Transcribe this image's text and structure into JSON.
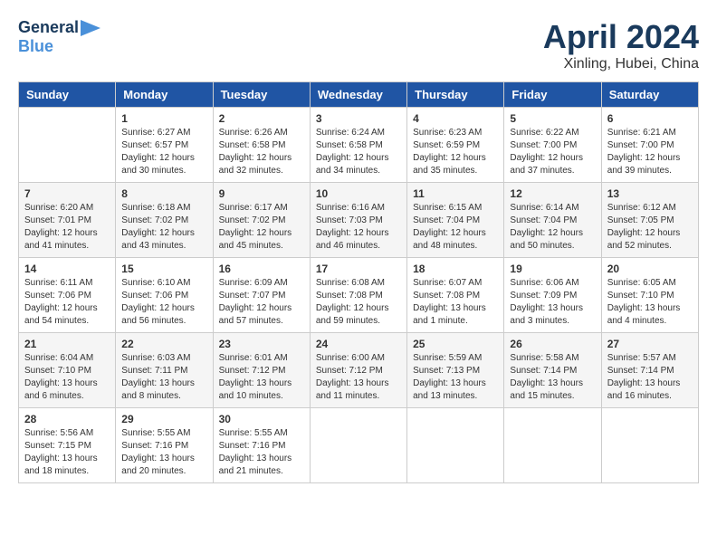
{
  "logo": {
    "line1": "General",
    "line2": "Blue"
  },
  "title": "April 2024",
  "location": "Xinling, Hubei, China",
  "headers": [
    "Sunday",
    "Monday",
    "Tuesday",
    "Wednesday",
    "Thursday",
    "Friday",
    "Saturday"
  ],
  "weeks": [
    [
      {
        "day": "",
        "detail": ""
      },
      {
        "day": "1",
        "detail": "Sunrise: 6:27 AM\nSunset: 6:57 PM\nDaylight: 12 hours\nand 30 minutes."
      },
      {
        "day": "2",
        "detail": "Sunrise: 6:26 AM\nSunset: 6:58 PM\nDaylight: 12 hours\nand 32 minutes."
      },
      {
        "day": "3",
        "detail": "Sunrise: 6:24 AM\nSunset: 6:58 PM\nDaylight: 12 hours\nand 34 minutes."
      },
      {
        "day": "4",
        "detail": "Sunrise: 6:23 AM\nSunset: 6:59 PM\nDaylight: 12 hours\nand 35 minutes."
      },
      {
        "day": "5",
        "detail": "Sunrise: 6:22 AM\nSunset: 7:00 PM\nDaylight: 12 hours\nand 37 minutes."
      },
      {
        "day": "6",
        "detail": "Sunrise: 6:21 AM\nSunset: 7:00 PM\nDaylight: 12 hours\nand 39 minutes."
      }
    ],
    [
      {
        "day": "7",
        "detail": "Sunrise: 6:20 AM\nSunset: 7:01 PM\nDaylight: 12 hours\nand 41 minutes."
      },
      {
        "day": "8",
        "detail": "Sunrise: 6:18 AM\nSunset: 7:02 PM\nDaylight: 12 hours\nand 43 minutes."
      },
      {
        "day": "9",
        "detail": "Sunrise: 6:17 AM\nSunset: 7:02 PM\nDaylight: 12 hours\nand 45 minutes."
      },
      {
        "day": "10",
        "detail": "Sunrise: 6:16 AM\nSunset: 7:03 PM\nDaylight: 12 hours\nand 46 minutes."
      },
      {
        "day": "11",
        "detail": "Sunrise: 6:15 AM\nSunset: 7:04 PM\nDaylight: 12 hours\nand 48 minutes."
      },
      {
        "day": "12",
        "detail": "Sunrise: 6:14 AM\nSunset: 7:04 PM\nDaylight: 12 hours\nand 50 minutes."
      },
      {
        "day": "13",
        "detail": "Sunrise: 6:12 AM\nSunset: 7:05 PM\nDaylight: 12 hours\nand 52 minutes."
      }
    ],
    [
      {
        "day": "14",
        "detail": "Sunrise: 6:11 AM\nSunset: 7:06 PM\nDaylight: 12 hours\nand 54 minutes."
      },
      {
        "day": "15",
        "detail": "Sunrise: 6:10 AM\nSunset: 7:06 PM\nDaylight: 12 hours\nand 56 minutes."
      },
      {
        "day": "16",
        "detail": "Sunrise: 6:09 AM\nSunset: 7:07 PM\nDaylight: 12 hours\nand 57 minutes."
      },
      {
        "day": "17",
        "detail": "Sunrise: 6:08 AM\nSunset: 7:08 PM\nDaylight: 12 hours\nand 59 minutes."
      },
      {
        "day": "18",
        "detail": "Sunrise: 6:07 AM\nSunset: 7:08 PM\nDaylight: 13 hours\nand 1 minute."
      },
      {
        "day": "19",
        "detail": "Sunrise: 6:06 AM\nSunset: 7:09 PM\nDaylight: 13 hours\nand 3 minutes."
      },
      {
        "day": "20",
        "detail": "Sunrise: 6:05 AM\nSunset: 7:10 PM\nDaylight: 13 hours\nand 4 minutes."
      }
    ],
    [
      {
        "day": "21",
        "detail": "Sunrise: 6:04 AM\nSunset: 7:10 PM\nDaylight: 13 hours\nand 6 minutes."
      },
      {
        "day": "22",
        "detail": "Sunrise: 6:03 AM\nSunset: 7:11 PM\nDaylight: 13 hours\nand 8 minutes."
      },
      {
        "day": "23",
        "detail": "Sunrise: 6:01 AM\nSunset: 7:12 PM\nDaylight: 13 hours\nand 10 minutes."
      },
      {
        "day": "24",
        "detail": "Sunrise: 6:00 AM\nSunset: 7:12 PM\nDaylight: 13 hours\nand 11 minutes."
      },
      {
        "day": "25",
        "detail": "Sunrise: 5:59 AM\nSunset: 7:13 PM\nDaylight: 13 hours\nand 13 minutes."
      },
      {
        "day": "26",
        "detail": "Sunrise: 5:58 AM\nSunset: 7:14 PM\nDaylight: 13 hours\nand 15 minutes."
      },
      {
        "day": "27",
        "detail": "Sunrise: 5:57 AM\nSunset: 7:14 PM\nDaylight: 13 hours\nand 16 minutes."
      }
    ],
    [
      {
        "day": "28",
        "detail": "Sunrise: 5:56 AM\nSunset: 7:15 PM\nDaylight: 13 hours\nand 18 minutes."
      },
      {
        "day": "29",
        "detail": "Sunrise: 5:55 AM\nSunset: 7:16 PM\nDaylight: 13 hours\nand 20 minutes."
      },
      {
        "day": "30",
        "detail": "Sunrise: 5:55 AM\nSunset: 7:16 PM\nDaylight: 13 hours\nand 21 minutes."
      },
      {
        "day": "",
        "detail": ""
      },
      {
        "day": "",
        "detail": ""
      },
      {
        "day": "",
        "detail": ""
      },
      {
        "day": "",
        "detail": ""
      }
    ]
  ]
}
